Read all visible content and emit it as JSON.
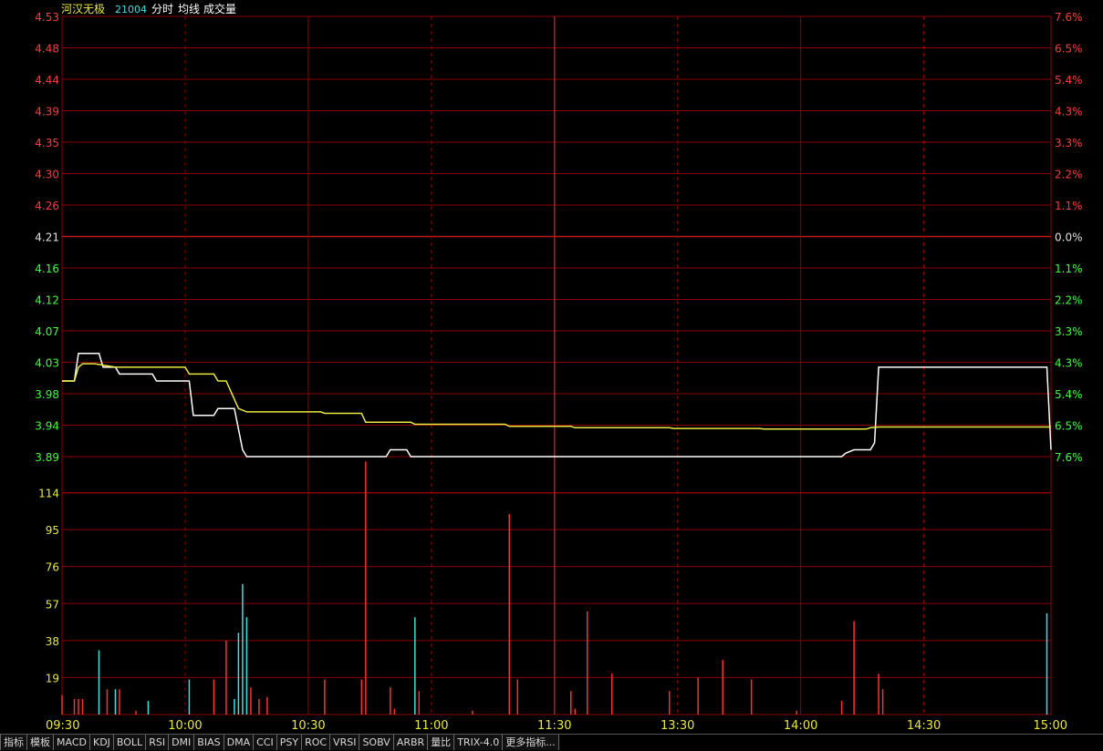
{
  "header": {
    "stock_name": "河汉无极",
    "stock_code": "21004",
    "mode_label": "分时",
    "ma_label": "均线",
    "volume_label": "成交量"
  },
  "colors": {
    "up": "#ff3a3a",
    "down": "#3cff3c",
    "flat": "#e0e0e0",
    "grid": "#8b0000",
    "price_line": "#ffffff",
    "avg_line": "#e8e840",
    "vol_up": "#ff3030",
    "vol_down": "#40e0e0",
    "header_name": "#e8e840",
    "header_code": "#40e0e0"
  },
  "chart_data": [
    {
      "type": "line",
      "name": "price",
      "prev_close": 4.21,
      "ylim": [
        3.89,
        4.53
      ],
      "y_ticks": [
        {
          "label": "4.53",
          "pct": "7.6%",
          "cls": "up"
        },
        {
          "label": "4.48",
          "pct": "6.5%",
          "cls": "up"
        },
        {
          "label": "4.44",
          "pct": "5.4%",
          "cls": "up"
        },
        {
          "label": "4.39",
          "pct": "4.3%",
          "cls": "up"
        },
        {
          "label": "4.35",
          "pct": "3.3%",
          "cls": "up"
        },
        {
          "label": "4.30",
          "pct": "2.2%",
          "cls": "up"
        },
        {
          "label": "4.26",
          "pct": "1.1%",
          "cls": "up"
        },
        {
          "label": "4.21",
          "pct": "0.0%",
          "cls": "flat"
        },
        {
          "label": "4.16",
          "pct": "1.1%",
          "cls": "down"
        },
        {
          "label": "4.12",
          "pct": "2.2%",
          "cls": "down"
        },
        {
          "label": "4.07",
          "pct": "3.3%",
          "cls": "down"
        },
        {
          "label": "4.03",
          "pct": "4.3%",
          "cls": "down"
        },
        {
          "label": "3.98",
          "pct": "5.4%",
          "cls": "down"
        },
        {
          "label": "3.94",
          "pct": "6.5%",
          "cls": "down"
        },
        {
          "label": "3.89",
          "pct": "7.6%",
          "cls": "down"
        }
      ],
      "x_ticks": [
        "09:30",
        "10:00",
        "10:30",
        "11:00",
        "11:30",
        "13:30",
        "14:00",
        "14:30",
        "15:00"
      ],
      "series": [
        {
          "name": "price",
          "points": [
            [
              0,
              4.0
            ],
            [
              3,
              4.0
            ],
            [
              4,
              4.04
            ],
            [
              9,
              4.04
            ],
            [
              10,
              4.02
            ],
            [
              13,
              4.02
            ],
            [
              14,
              4.01
            ],
            [
              22,
              4.01
            ],
            [
              23,
              4.0
            ],
            [
              31,
              4.0
            ],
            [
              32,
              3.95
            ],
            [
              37,
              3.95
            ],
            [
              38,
              3.96
            ],
            [
              42,
              3.96
            ],
            [
              43,
              3.93
            ],
            [
              44,
              3.9
            ],
            [
              45,
              3.89
            ],
            [
              79,
              3.89
            ],
            [
              80,
              3.9
            ],
            [
              84,
              3.9
            ],
            [
              85,
              3.89
            ],
            [
              190,
              3.89
            ],
            [
              191,
              3.895
            ],
            [
              193,
              3.9
            ],
            [
              197,
              3.9
            ],
            [
              198,
              3.91
            ],
            [
              199,
              4.02
            ],
            [
              240,
              4.02
            ],
            [
              241,
              3.9
            ]
          ]
        },
        {
          "name": "avg",
          "points": [
            [
              0,
              4.0
            ],
            [
              3,
              4.0
            ],
            [
              4,
              4.02
            ],
            [
              5,
              4.025
            ],
            [
              8,
              4.025
            ],
            [
              13,
              4.02
            ],
            [
              30,
              4.02
            ],
            [
              31,
              4.01
            ],
            [
              37,
              4.01
            ],
            [
              38,
              4.0
            ],
            [
              40,
              4.0
            ],
            [
              43,
              3.96
            ],
            [
              45,
              3.955
            ],
            [
              63,
              3.955
            ],
            [
              64,
              3.953
            ],
            [
              73,
              3.953
            ],
            [
              74,
              3.94
            ],
            [
              85,
              3.94
            ],
            [
              86,
              3.937
            ],
            [
              108,
              3.937
            ],
            [
              109,
              3.934
            ],
            [
              124,
              3.934
            ],
            [
              125,
              3.932
            ],
            [
              148,
              3.932
            ],
            [
              149,
              3.931
            ],
            [
              170,
              3.931
            ],
            [
              171,
              3.93
            ],
            [
              196,
              3.93
            ],
            [
              197,
              3.932
            ],
            [
              199,
              3.933
            ],
            [
              241,
              3.933
            ]
          ]
        }
      ]
    },
    {
      "type": "bar",
      "name": "volume",
      "ylim": [
        0,
        114
      ],
      "y_ticks": [
        "114",
        "95",
        "76",
        "57",
        "38",
        "19"
      ],
      "bars": [
        [
          0,
          10,
          "u"
        ],
        [
          3,
          8,
          "u"
        ],
        [
          4,
          8,
          "u"
        ],
        [
          5,
          8,
          "u"
        ],
        [
          9,
          33,
          "d"
        ],
        [
          11,
          13,
          "u"
        ],
        [
          13,
          13,
          "d"
        ],
        [
          14,
          13,
          "u"
        ],
        [
          18,
          2,
          "u"
        ],
        [
          21,
          7,
          "d"
        ],
        [
          31,
          18,
          "d"
        ],
        [
          37,
          18,
          "u"
        ],
        [
          40,
          38,
          "u"
        ],
        [
          42,
          8,
          "d"
        ],
        [
          43,
          42,
          "d"
        ],
        [
          44,
          67,
          "d"
        ],
        [
          45,
          50,
          "d"
        ],
        [
          46,
          14,
          "u"
        ],
        [
          48,
          8,
          "u"
        ],
        [
          50,
          9,
          "u"
        ],
        [
          64,
          18,
          "u"
        ],
        [
          73,
          18,
          "u"
        ],
        [
          74,
          130,
          "u"
        ],
        [
          80,
          14,
          "u"
        ],
        [
          81,
          3,
          "u"
        ],
        [
          86,
          50,
          "d"
        ],
        [
          87,
          12,
          "u"
        ],
        [
          100,
          2,
          "u"
        ],
        [
          109,
          103,
          "u"
        ],
        [
          111,
          18,
          "u"
        ],
        [
          124,
          12,
          "u"
        ],
        [
          125,
          3,
          "u"
        ],
        [
          128,
          53,
          "u"
        ],
        [
          134,
          21,
          "u"
        ],
        [
          148,
          12,
          "u"
        ],
        [
          155,
          19,
          "u"
        ],
        [
          161,
          28,
          "u"
        ],
        [
          168,
          18,
          "u"
        ],
        [
          179,
          2,
          "u"
        ],
        [
          190,
          7,
          "u"
        ],
        [
          193,
          48,
          "u"
        ],
        [
          199,
          21,
          "u"
        ],
        [
          200,
          13,
          "u"
        ],
        [
          240,
          52,
          "d"
        ]
      ]
    }
  ],
  "tabs": [
    "指标",
    "模板",
    "MACD",
    "KDJ",
    "BOLL",
    "RSI",
    "DMI",
    "BIAS",
    "DMA",
    "CCI",
    "PSY",
    "ROC",
    "VRSI",
    "SOBV",
    "ARBR",
    "量比",
    "TRIX-4.0",
    "更多指标..."
  ]
}
